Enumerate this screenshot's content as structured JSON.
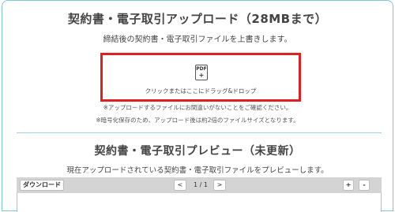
{
  "upload": {
    "title": "契約書・電子取引アップロード（28MBまで）",
    "description": "締結後の契約書・電子取引ファイルを上書きします。",
    "dropzone": {
      "icon_label": "PDF",
      "icon_plus": "+",
      "icon": "pdf-add-icon",
      "label": "クリックまたはここにドラッグ&ドロップ",
      "highlight_color": "#e02020"
    },
    "note1": "※アップロードするファイルにお間違いがないことをご確認ください。",
    "note2": "※暗号化保存のため、アップロード後は約2倍のファイルサイズとなります。"
  },
  "preview": {
    "title": "契約書・電子取引プレビュー（未更新）",
    "description": "現在アップロードされている契約書・電子取引ファイルをプレビューします。",
    "toolbar": {
      "download_label": "ダウンロード",
      "prev_label": "<",
      "page_indicator": "1 / 1",
      "next_label": ">",
      "zoom_in_label": "+",
      "zoom_out_label": "-"
    }
  },
  "colors": {
    "card_border": "#7fc8d8",
    "toolbar_bg": "#d4d4d4"
  }
}
